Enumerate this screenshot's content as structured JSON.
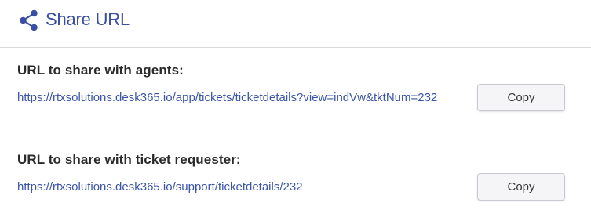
{
  "header": {
    "title": "Share URL",
    "icon": "share-icon",
    "color": "#3a4ea3"
  },
  "agents": {
    "label": "URL to share with agents:",
    "url": "https://rtxsolutions.desk365.io/app/tickets/ticketdetails?view=indVw&tktNum=232",
    "copy_label": "Copy"
  },
  "requester": {
    "label": "URL to share with ticket requester:",
    "url": "https://rtxsolutions.desk365.io/support/ticketdetails/232",
    "copy_label": "Copy"
  },
  "colors": {
    "link": "#3b55a8",
    "text": "#2b2b2b",
    "button_bg": "#f5f5f7",
    "divider": "#d9d9de"
  }
}
